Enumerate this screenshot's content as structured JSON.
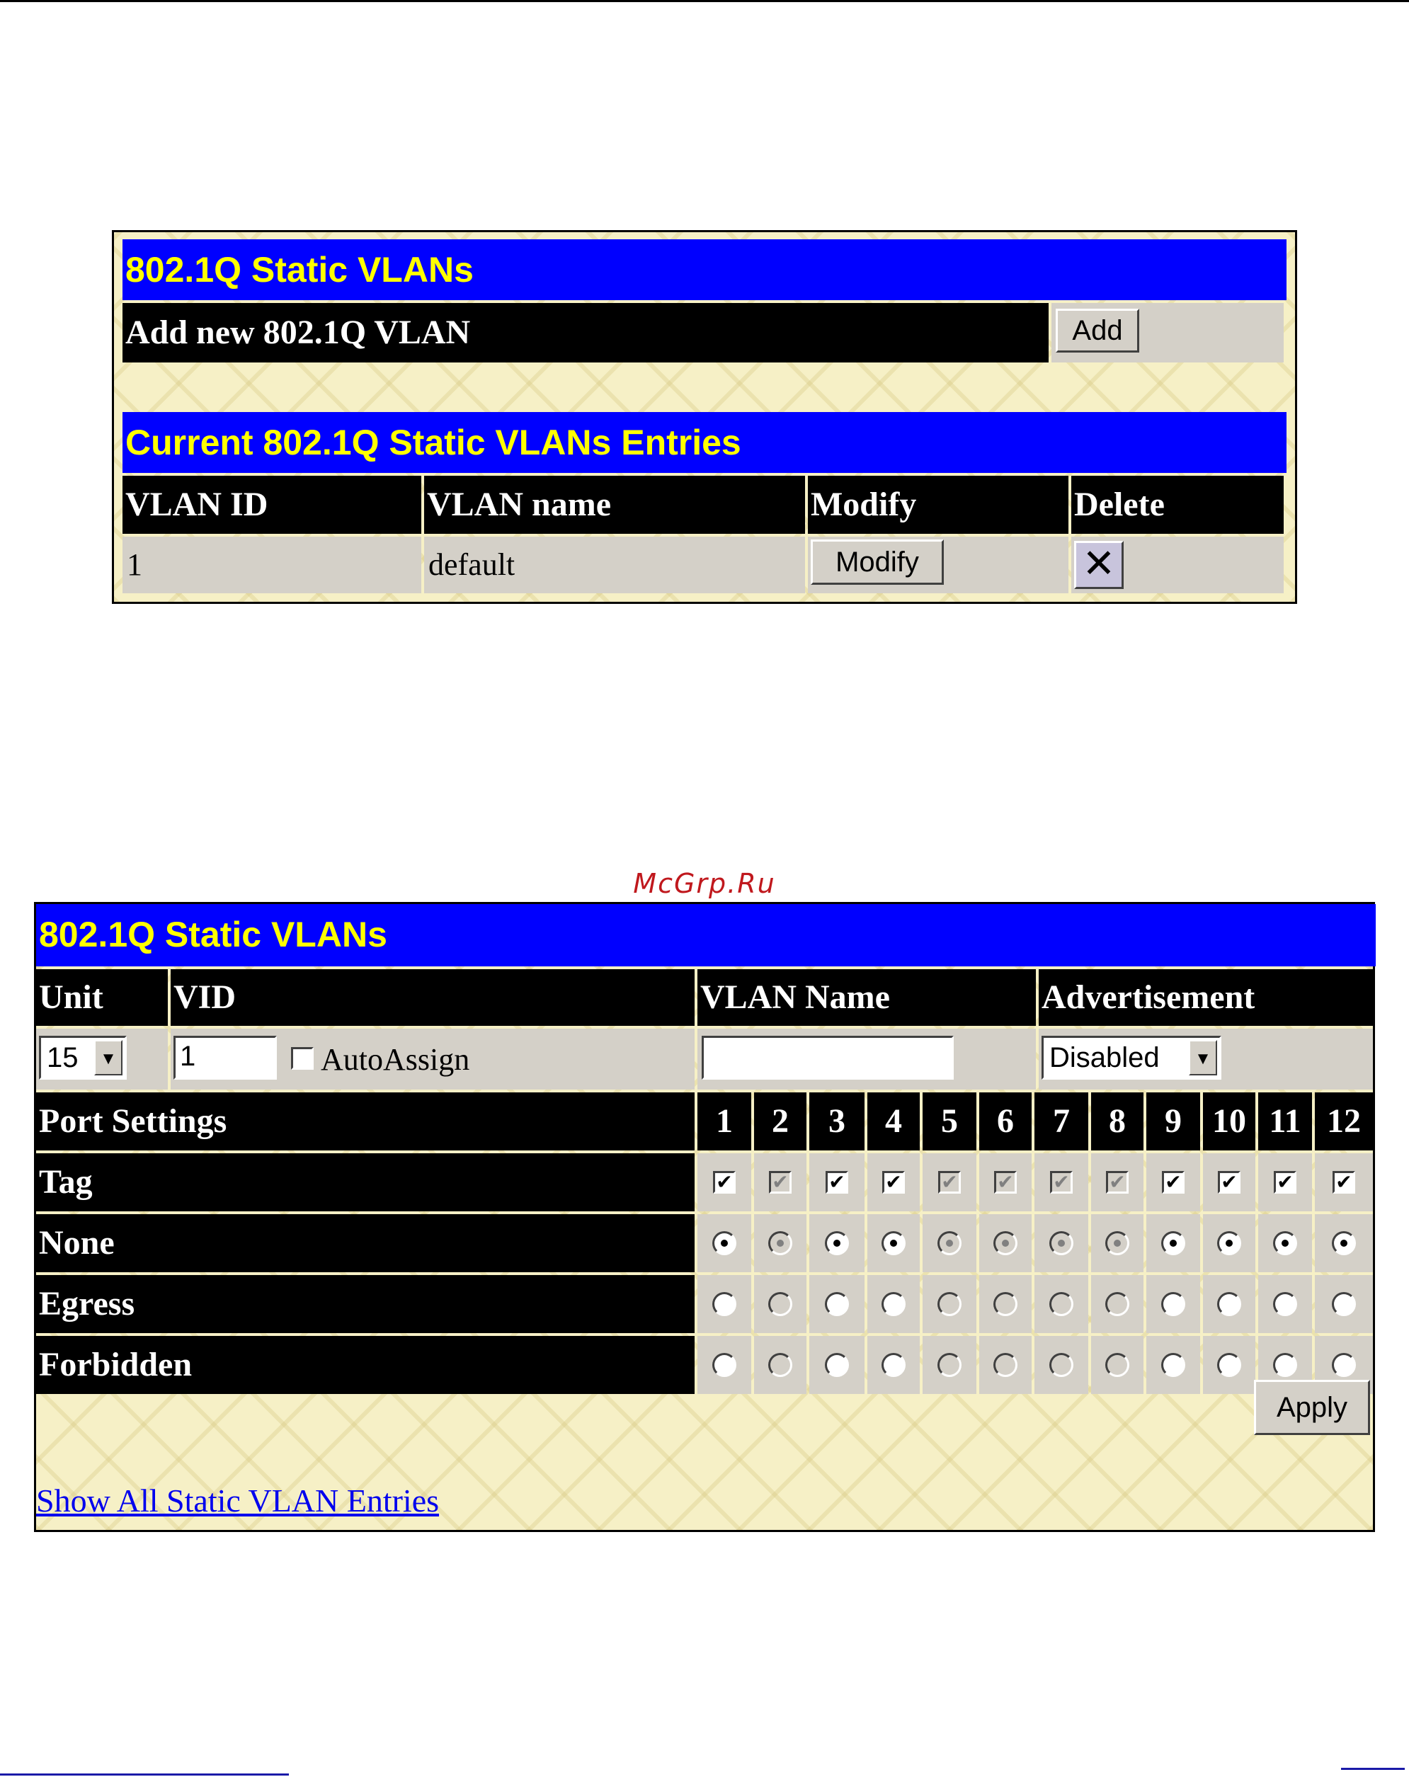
{
  "watermark": "McGrp.Ru",
  "panel1": {
    "title": "802.1Q Static VLANs",
    "add_label": "Add new 802.1Q VLAN",
    "add_button": "Add",
    "entries_title": "Current 802.1Q Static VLANs Entries",
    "columns": [
      "VLAN ID",
      "VLAN name",
      "Modify",
      "Delete"
    ],
    "rows": [
      {
        "vlan_id": "1",
        "vlan_name": "default",
        "modify_button": "Modify",
        "delete_icon": "close-x-icon"
      }
    ]
  },
  "panel2": {
    "title": "802.1Q Static VLANs",
    "headers": {
      "unit": "Unit",
      "vid": "VID",
      "vlan_name": "VLAN Name",
      "advertisement": "Advertisement"
    },
    "unit_value": "15",
    "vid_value": "1",
    "autoassign_label": "AutoAssign",
    "autoassign_checked": false,
    "vlan_name_value": "",
    "advertisement_value": "Disabled",
    "port_settings_label": "Port Settings",
    "ports": [
      "1",
      "2",
      "3",
      "4",
      "5",
      "6",
      "7",
      "8",
      "9",
      "10",
      "11",
      "12"
    ],
    "disabled_ports": [
      2,
      5,
      6,
      7,
      8
    ],
    "rows": [
      {
        "label": "Tag",
        "type": "checkbox",
        "checked": true
      },
      {
        "label": "None",
        "type": "radio",
        "checked": true
      },
      {
        "label": "Egress",
        "type": "radio",
        "checked": false
      },
      {
        "label": "Forbidden",
        "type": "radio",
        "checked": false
      }
    ],
    "apply_button": "Apply",
    "show_all_link": "Show All Static VLAN Entries"
  },
  "colors": {
    "header_bg": "#0000ff",
    "header_text": "#ffff00",
    "label_bg": "#000000",
    "cell_bg": "#d4d0c8"
  }
}
